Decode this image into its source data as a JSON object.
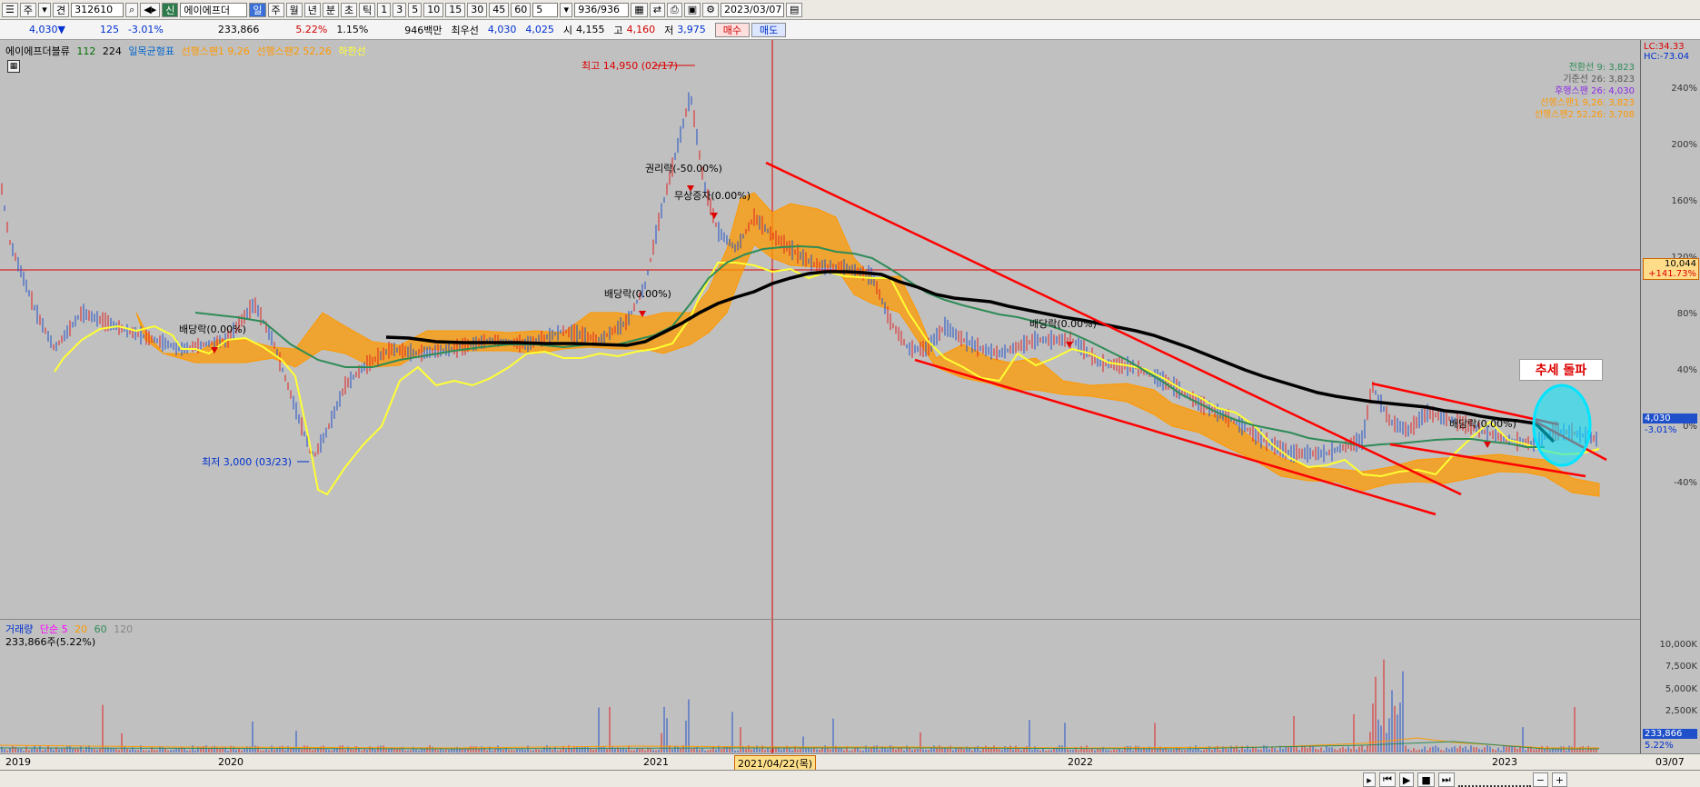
{
  "toolbar": {
    "btn_a": "주",
    "btn_b": "견",
    "code": "312610",
    "credit": "신",
    "name": "에이에프더",
    "periods": [
      "일",
      "주",
      "월",
      "년",
      "분",
      "초",
      "틱"
    ],
    "nums": [
      "1",
      "3",
      "5",
      "10",
      "15",
      "30",
      "45",
      "60"
    ],
    "count_sel": "5",
    "range": "936/936",
    "date": "2023/03/07"
  },
  "quote": {
    "price": "4,030▼",
    "change": "125",
    "change_pct": "-3.01%",
    "volume": "233,866",
    "vol_pct": "5.22%",
    "turnover": "1.15%",
    "amount": "946백만",
    "best_label": "최우선",
    "best_ask": "4,030",
    "best_bid": "4,025",
    "open_label": "시",
    "open": "4,155",
    "high_label": "고",
    "high": "4,160",
    "low_label": "저",
    "low": "3,975",
    "buy": "매수",
    "sell": "매도"
  },
  "price_legend": {
    "stock": "에이에프더블류",
    "n1": "112",
    "n2": "224",
    "ichimoku": "일목균형표",
    "span1": "선행스팬1 9,26",
    "span2": "선행스팬2 52,26",
    "lagging": "하한선"
  },
  "ichimoku_values": {
    "conv": "전환선 9: 3,823",
    "base": "기준선 26: 3,823",
    "lag": "후행스팬 26: 4,030",
    "s1": "선행스팬1 9,26: 3,823",
    "s2": "선행스팬2 52,26: 3,708"
  },
  "annotations": {
    "high": "최고 14,950 (02/17)",
    "low": "최저 3,000 (03/23)",
    "rights": "권리락(-50.00%)",
    "bonus": "무상증자(0.00%)",
    "div1": "배당락(0.00%)",
    "div2": "배당락(0.00%)",
    "div3": "배당락(0.00%)",
    "div4": "배당락(0.00%)",
    "breakout": "추세 돌파"
  },
  "price_axis": {
    "lc": "LC:34.33",
    "hc": "HC:-73.04",
    "ticks": [
      "240%",
      "200%",
      "160%",
      "120%",
      "80%",
      "40%",
      "0%",
      "-40%"
    ],
    "crosshair_price": "10,044",
    "crosshair_pct": "+141.73%",
    "current_price": "4,030",
    "current_pct": "-3.01%"
  },
  "volume_legend": {
    "name": "거래량",
    "ma_label": "단순 5",
    "m20": "20",
    "m60": "60",
    "m120": "120",
    "value": "233,866주(5.22%)"
  },
  "volume_axis": {
    "ticks": [
      "10,000K",
      "7,500K",
      "5,000K",
      "2,500K"
    ],
    "current": "233,866",
    "current_pct": "5.22%"
  },
  "date_axis": {
    "labels": [
      "2019",
      "2020",
      "2021",
      "2022",
      "2023"
    ],
    "crosshair": "2021/04/22(목)",
    "end": "03/07"
  },
  "colors": {
    "cloud": "#ff9900",
    "ma_black": "#000000",
    "ma_green": "#2e8b57",
    "lower_band": "#ffff33",
    "trendline": "#ff0000",
    "highlight": "#00e5ff"
  },
  "icons": [
    "search-icon",
    "sound-icon",
    "grid-icon",
    "save-icon",
    "gear-icon",
    "calendar-icon",
    "chevron-down-icon"
  ]
}
